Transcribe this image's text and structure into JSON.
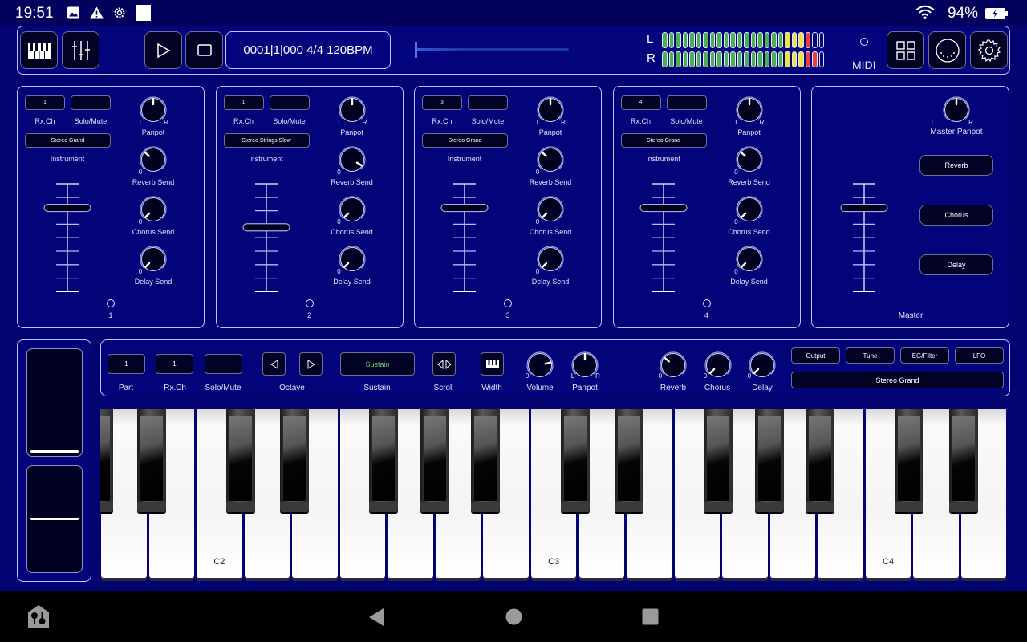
{
  "status_bar": {
    "time": "19:51",
    "left_icons": [
      "image-icon",
      "warning-icon",
      "settings-gear-icon",
      "white-square-icon"
    ],
    "battery_percent": "94%",
    "wifi": "wifi-icon",
    "battery": "battery-charging-icon"
  },
  "toolbar": {
    "keyboard_button": "keyboard-view-icon",
    "mixer_button": "mixer-view-icon",
    "play_button": "play-icon",
    "stop_button": "stop-icon",
    "position_display": "0001|1|000 4/4 120BPM",
    "song_position": 0.0,
    "meter_left_label": "L",
    "meter_right_label": "R",
    "meter_segments": 24,
    "meter_left_lit": 22,
    "meter_right_lit": 23,
    "meter_colors": {
      "green": "#4caf50",
      "yellow": "#f0e040",
      "red": "#e84040"
    },
    "midi_label": "MIDI",
    "grid_button": "grid-icon",
    "midi_port_button": "midi-din-icon",
    "settings_button": "gear-icon"
  },
  "parts": [
    {
      "number": "1",
      "rx_ch": "1",
      "solo_mute": "",
      "instrument": "Stereo Grand",
      "panpot": 0.5,
      "reverb_send": 0.32,
      "chorus_send": 0.0,
      "delay_send": 0.0,
      "volume": 0.78
    },
    {
      "number": "2",
      "rx_ch": "1",
      "solo_mute": "",
      "instrument": "Stereo Strings Slow",
      "panpot": 0.5,
      "reverb_send": 0.95,
      "chorus_send": 0.0,
      "delay_send": 0.0,
      "volume": 0.6
    },
    {
      "number": "3",
      "rx_ch": "3",
      "solo_mute": "",
      "instrument": "Stereo Grand",
      "panpot": 0.5,
      "reverb_send": 0.32,
      "chorus_send": 0.0,
      "delay_send": 0.0,
      "volume": 0.78
    },
    {
      "number": "4",
      "rx_ch": "4",
      "solo_mute": "",
      "instrument": "Stereo Grand",
      "panpot": 0.5,
      "reverb_send": 0.32,
      "chorus_send": 0.0,
      "delay_send": 0.0,
      "volume": 0.78
    }
  ],
  "part_labels": {
    "rx_ch": "Rx.Ch",
    "solo_mute": "Solo/Mute",
    "instrument": "Instrument",
    "panpot": "Panpot",
    "reverb_send": "Reverb Send",
    "chorus_send": "Chorus Send",
    "delay_send": "Delay Send",
    "knob_left": "L",
    "knob_right": "R",
    "knob_zero": "0"
  },
  "master": {
    "panpot_label": "Master Panpot",
    "panpot": 0.5,
    "reverb_button": "Reverb",
    "chorus_button": "Chorus",
    "delay_button": "Delay",
    "volume": 0.78,
    "label": "Master"
  },
  "controller": {
    "part": "1",
    "rx_ch": "1",
    "solo_mute": "",
    "labels": {
      "part": "Part",
      "rx_ch": "Rx.Ch",
      "solo_mute": "Solo/Mute",
      "octave": "Octave",
      "sustain": "Sustain",
      "scroll": "Scroll",
      "width": "Width",
      "volume": "Volume",
      "panpot": "Panpot",
      "reverb": "Reverb",
      "chorus": "Chorus",
      "delay": "Delay"
    },
    "sustain_button": "Sustain",
    "sustain_color": "#6ec46e",
    "volume": 0.78,
    "panpot": 0.5,
    "reverb": 0.32,
    "chorus": 0.0,
    "delay": 0.0,
    "tabs": [
      "Output",
      "Tune",
      "EG/Filter",
      "LFO"
    ],
    "instrument": "Stereo Grand"
  },
  "wheels": {
    "pitch_bend": 0.0,
    "modulation": 0.5
  },
  "keyboard": {
    "first_white_note": "A1",
    "white_key_count": 19,
    "octave_labels": [
      {
        "note": "C2",
        "white_index": 2
      },
      {
        "note": "C3",
        "white_index": 9
      },
      {
        "note": "C4",
        "white_index": 16
      }
    ]
  },
  "nav_bar": {
    "app_icon": "app-home-icon",
    "back": "back-icon",
    "home": "home-icon",
    "recents": "recents-icon"
  }
}
